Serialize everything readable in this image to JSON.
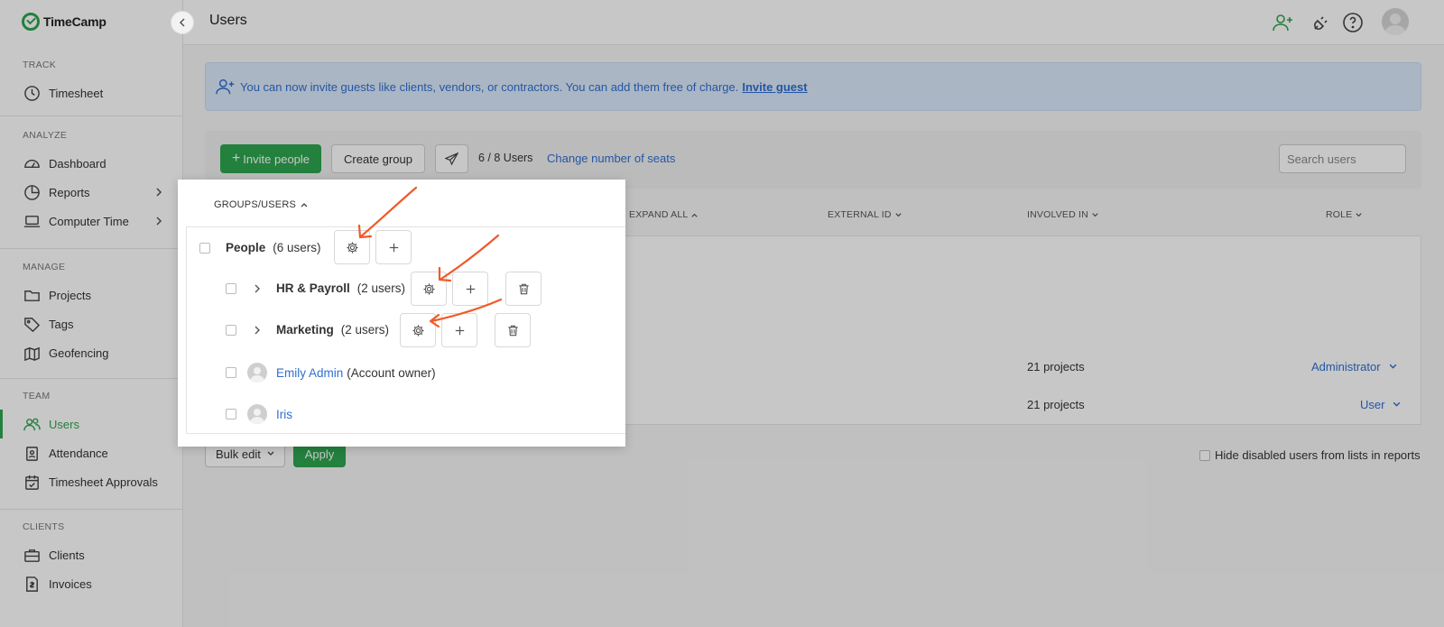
{
  "app": {
    "name": "TimeCamp"
  },
  "sidebar": {
    "sections": [
      {
        "title": "TRACK",
        "items": [
          {
            "label": "Timesheet",
            "icon": "clock-icon"
          }
        ]
      },
      {
        "title": "ANALYZE",
        "items": [
          {
            "label": "Dashboard",
            "icon": "gauge-icon"
          },
          {
            "label": "Reports",
            "icon": "pie-chart-icon",
            "has_submenu": true
          },
          {
            "label": "Computer Time",
            "icon": "laptop-icon",
            "has_submenu": true
          }
        ]
      },
      {
        "title": "MANAGE",
        "items": [
          {
            "label": "Projects",
            "icon": "folder-icon"
          },
          {
            "label": "Tags",
            "icon": "tag-icon"
          },
          {
            "label": "Geofencing",
            "icon": "map-icon"
          }
        ]
      },
      {
        "title": "TEAM",
        "items": [
          {
            "label": "Users",
            "icon": "users-icon",
            "active": true
          },
          {
            "label": "Attendance",
            "icon": "badge-icon"
          },
          {
            "label": "Timesheet Approvals",
            "icon": "calendar-check-icon"
          }
        ]
      },
      {
        "title": "CLIENTS",
        "items": [
          {
            "label": "Clients",
            "icon": "briefcase-icon"
          },
          {
            "label": "Invoices",
            "icon": "invoice-icon"
          }
        ]
      }
    ]
  },
  "header": {
    "title": "Users"
  },
  "banner": {
    "text": "You can now invite guests like clients, vendors, or contractors. You can add them free of charge.",
    "link": "Invite guest"
  },
  "toolbar": {
    "invite_label": "Invite people",
    "create_group_label": "Create group",
    "seats": "6 / 8 Users",
    "change_seats_label": "Change number of seats",
    "search_placeholder": "Search users"
  },
  "table": {
    "headers": {
      "expand_all": "EXPAND ALL",
      "external_id": "EXTERNAL ID",
      "involved_in": "INVOLVED IN",
      "role": "ROLE"
    },
    "rows": [
      {
        "involved": "21 projects",
        "role": "Administrator"
      },
      {
        "involved": "21 projects",
        "role": "User"
      }
    ]
  },
  "footer": {
    "bulk_edit_label": "Bulk edit",
    "apply_label": "Apply",
    "hide_disabled_label": "Hide disabled users from lists in reports"
  },
  "panel": {
    "header": "GROUPS/USERS",
    "root": {
      "name": "People",
      "count": "(6 users)"
    },
    "groups": [
      {
        "name": "HR & Payroll",
        "count": "(2 users)"
      },
      {
        "name": "Marketing",
        "count": "(2 users)"
      }
    ],
    "users": [
      {
        "name": "Emily Admin",
        "note": "(Account owner)"
      },
      {
        "name": "Iris",
        "note": ""
      }
    ]
  },
  "colors": {
    "accent": "#2ea44f",
    "link": "#2f6fd1",
    "annotation": "#f05a28"
  }
}
